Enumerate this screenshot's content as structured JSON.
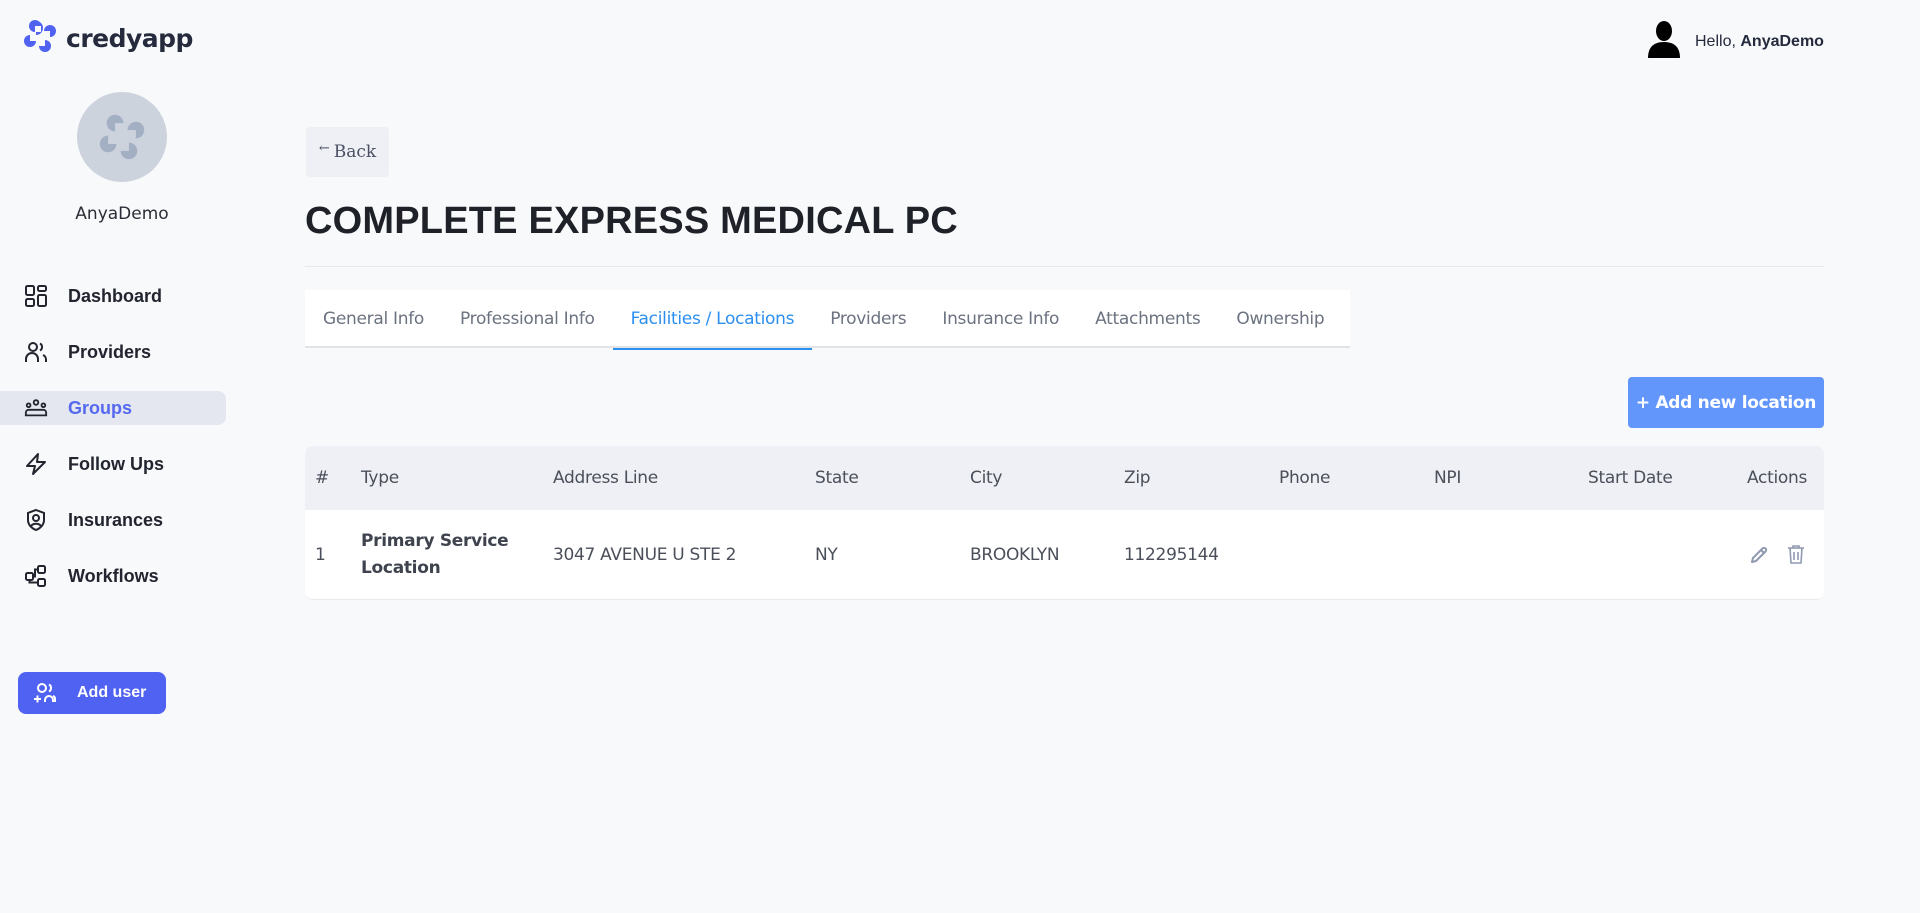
{
  "app": {
    "brand": "credyapp",
    "brand_color": "#4f62f1",
    "accent_color": "#2b8ff0"
  },
  "header": {
    "greeting_prefix": "Hello, ",
    "username": "AnyaDemo",
    "user_icon": "user-silhouette-icon"
  },
  "sidebar": {
    "profile_name": "AnyaDemo",
    "items": [
      {
        "label": "Dashboard",
        "icon": "grid-icon",
        "active": false
      },
      {
        "label": "Providers",
        "icon": "users-icon",
        "active": false
      },
      {
        "label": "Groups",
        "icon": "group-icon",
        "active": true
      },
      {
        "label": "Follow Ups",
        "icon": "lightning-icon",
        "active": false
      },
      {
        "label": "Insurances",
        "icon": "shield-user-icon",
        "active": false
      },
      {
        "label": "Workflows",
        "icon": "workflow-icon",
        "active": false
      }
    ],
    "add_user_label": "Add user"
  },
  "main": {
    "back_label": "Back",
    "title": "COMPLETE EXPRESS MEDICAL PC",
    "tabs": [
      {
        "label": "General Info",
        "active": false
      },
      {
        "label": "Professional Info",
        "active": false
      },
      {
        "label": "Facilities / Locations",
        "active": true
      },
      {
        "label": "Providers",
        "active": false
      },
      {
        "label": "Insurance Info",
        "active": false
      },
      {
        "label": "Attachments",
        "active": false
      },
      {
        "label": "Ownership",
        "active": false
      }
    ],
    "add_location_label": "+ Add new location",
    "table": {
      "columns": [
        "#",
        "Type",
        "Address Line",
        "State",
        "City",
        "Zip",
        "Phone",
        "NPI",
        "Start Date",
        "Actions"
      ],
      "rows": [
        {
          "index": "1",
          "type": "Primary Service Location",
          "address": "3047 AVENUE U STE 2",
          "state": "NY",
          "city": "BROOKLYN",
          "zip": "112295144",
          "phone": "",
          "npi": "",
          "start_date": "",
          "actions": [
            "edit-icon",
            "trash-icon"
          ]
        }
      ]
    }
  }
}
